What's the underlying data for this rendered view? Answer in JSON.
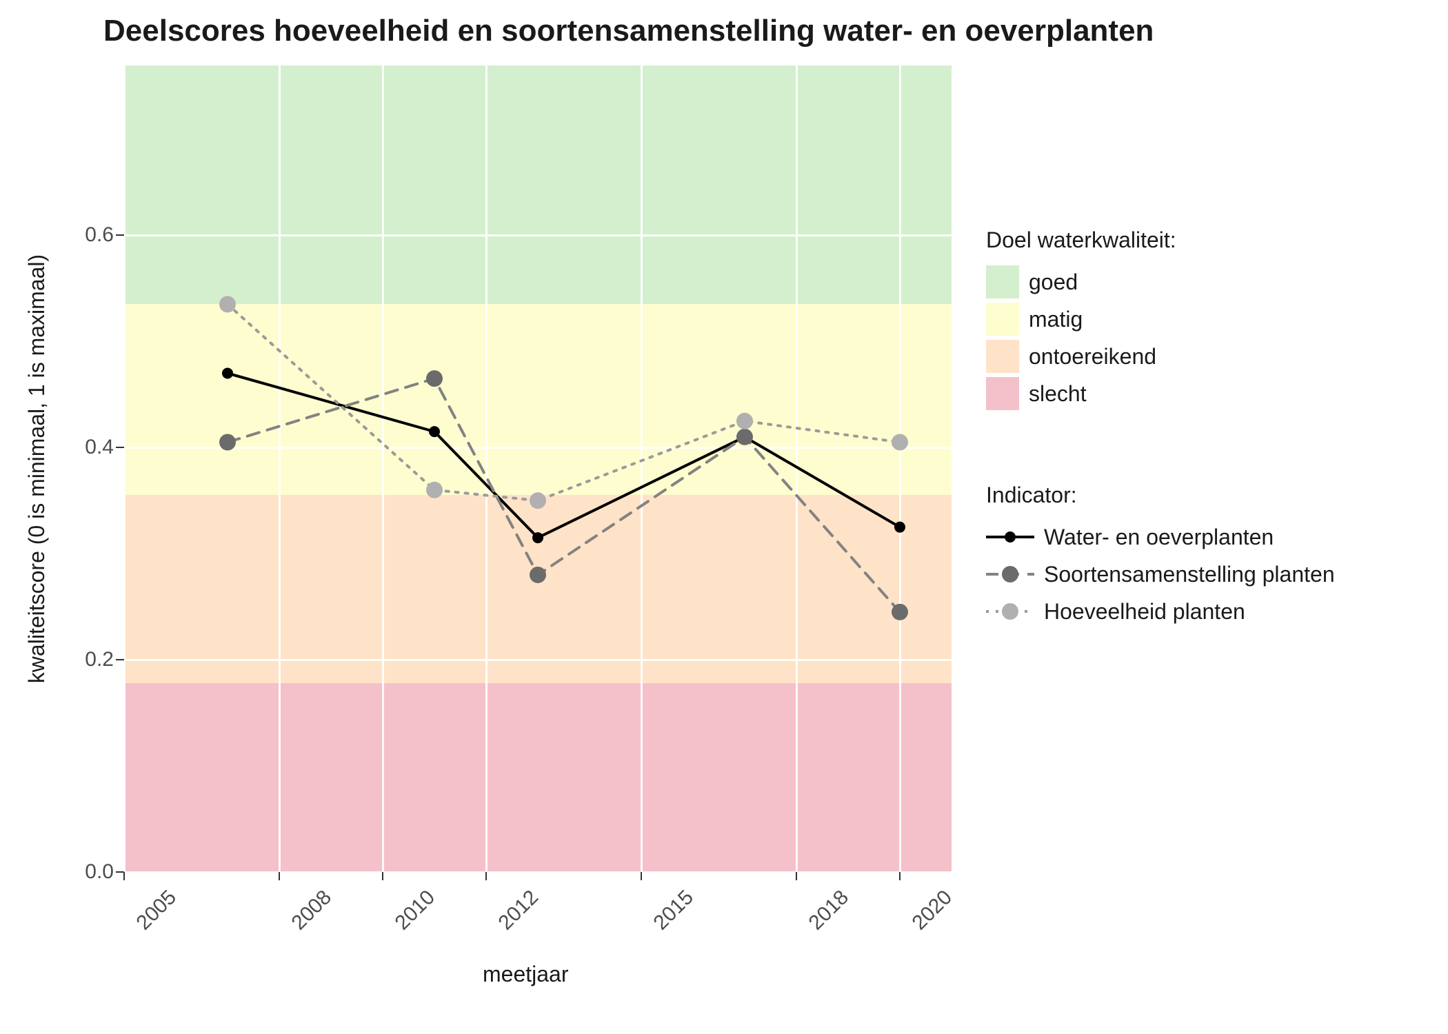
{
  "title": "Deelscores hoeveelheid en soortensamenstelling water- en oeverplanten",
  "xlabel": "meetjaar",
  "ylabel": "kwaliteitscore (0 is minimaal, 1 is maximaal)",
  "x_ticks": [
    2005,
    2008,
    2010,
    2012,
    2015,
    2018,
    2020
  ],
  "x_range": [
    2005,
    2021
  ],
  "y_ticks": [
    0.0,
    0.2,
    0.4,
    0.6
  ],
  "y_range": [
    0.0,
    0.76
  ],
  "bands": [
    {
      "name": "slecht",
      "from": 0.0,
      "to": 0.178,
      "color": "#f4c1cb"
    },
    {
      "name": "ontoereikend",
      "from": 0.178,
      "to": 0.355,
      "color": "#ffe3c8"
    },
    {
      "name": "matig",
      "from": 0.355,
      "to": 0.535,
      "color": "#fdfdcf"
    },
    {
      "name": "goed",
      "from": 0.535,
      "to": 0.76,
      "color": "#d4efce"
    }
  ],
  "legend_quality": {
    "title": "Doel waterkwaliteit:",
    "items": [
      "goed",
      "matig",
      "ontoereikend",
      "slecht"
    ]
  },
  "legend_indicator": {
    "title": "Indicator:",
    "items": [
      "Water- en oeverplanten",
      "Soortensamenstelling planten",
      "Hoeveelheid planten"
    ]
  },
  "chart_data": {
    "type": "line",
    "x": [
      2007,
      2011,
      2013,
      2017,
      2020
    ],
    "xlabel": "meetjaar",
    "ylabel": "kwaliteitscore (0 is minimaal, 1 is maximaal)",
    "title": "Deelscores hoeveelheid en soortensamenstelling water- en oeverplanten",
    "ylim": [
      0.0,
      0.76
    ],
    "xlim": [
      2005,
      2021
    ],
    "series": [
      {
        "name": "Water- en oeverplanten",
        "values": [
          0.47,
          0.415,
          0.315,
          0.41,
          0.325
        ],
        "style": "solid",
        "color": "#000000",
        "marker_color": "#000000",
        "marker_r": 8
      },
      {
        "name": "Soortensamenstelling planten",
        "values": [
          0.405,
          0.465,
          0.28,
          0.41,
          0.245
        ],
        "style": "dashed",
        "color": "#828282",
        "marker_color": "#6b6b6b",
        "marker_r": 12
      },
      {
        "name": "Hoeveelheid planten",
        "values": [
          0.535,
          0.36,
          0.35,
          0.425,
          0.405
        ],
        "style": "dotted",
        "color": "#9a9a9a",
        "marker_color": "#b0b0b0",
        "marker_r": 12
      }
    ],
    "quality_bands": [
      {
        "label": "goed",
        "ymin": 0.535,
        "ymax": 0.76,
        "color": "#d4efce"
      },
      {
        "label": "matig",
        "ymin": 0.355,
        "ymax": 0.535,
        "color": "#fdfdcf"
      },
      {
        "label": "ontoereikend",
        "ymin": 0.178,
        "ymax": 0.355,
        "color": "#ffe3c8"
      },
      {
        "label": "slecht",
        "ymin": 0.0,
        "ymax": 0.178,
        "color": "#f4c1cb"
      }
    ]
  }
}
